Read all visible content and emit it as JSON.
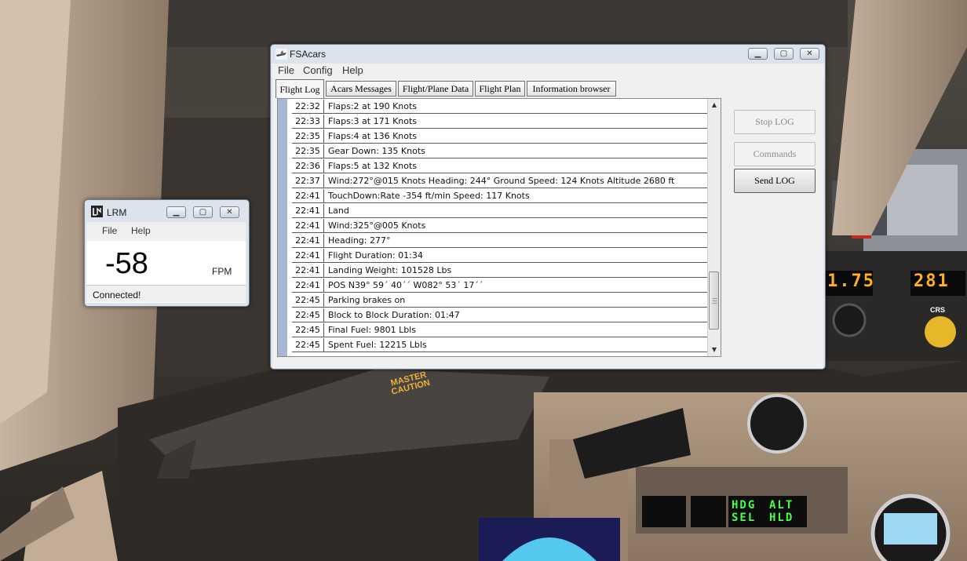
{
  "scene": {
    "caution_line1": "MASTER",
    "caution_line2": "CAUTION",
    "led_course_left": "1.75",
    "led_course_right": "281",
    "crs_label": "CRS",
    "fma_left": "HDG SEL",
    "fma_right": "ALT HLD"
  },
  "fsacars": {
    "title": "FSAcars",
    "menu": [
      "File",
      "Config",
      "Help"
    ],
    "tabs": [
      "Flight Log",
      "Acars Messages",
      "Flight/Plane Data",
      "Flight Plan",
      "Information browser"
    ],
    "active_tab": "Flight Log",
    "log": [
      {
        "time": "22:32",
        "text": "Flaps:2 at 190 Knots"
      },
      {
        "time": "22:33",
        "text": "Flaps:3 at 171 Knots"
      },
      {
        "time": "22:35",
        "text": "Flaps:4 at 136 Knots"
      },
      {
        "time": "22:35",
        "text": "Gear Down: 135 Knots"
      },
      {
        "time": "22:36",
        "text": "Flaps:5 at 132 Knots"
      },
      {
        "time": "22:37",
        "text": "Wind:272°@015 Knots Heading: 244° Ground Speed: 124 Knots Altitude 2680 ft"
      },
      {
        "time": "22:41",
        "text": "TouchDown:Rate -354 ft/min Speed: 117 Knots"
      },
      {
        "time": "22:41",
        "text": "Land"
      },
      {
        "time": "22:41",
        "text": "Wind:325°@005 Knots"
      },
      {
        "time": "22:41",
        "text": "Heading: 277°"
      },
      {
        "time": "22:41",
        "text": "Flight Duration: 01:34"
      },
      {
        "time": "22:41",
        "text": "Landing Weight: 101528 Lbs"
      },
      {
        "time": "22:41",
        "text": "POS N39° 59´ 40´´ W082° 53´ 17´´"
      },
      {
        "time": "22:45",
        "text": "Parking brakes on"
      },
      {
        "time": "22:45",
        "text": "Block to Block Duration: 01:47"
      },
      {
        "time": "22:45",
        "text": "Final Fuel: 9801 Lbls"
      },
      {
        "time": "22:45",
        "text": "Spent Fuel: 12215 Lbls"
      }
    ],
    "buttons": {
      "stop_log": "Stop LOG",
      "commands": "Commands",
      "send_log": "Send LOG"
    }
  },
  "lrm": {
    "title": "LRM",
    "menu": [
      "File",
      "Help"
    ],
    "value": "-58",
    "unit": "FPM",
    "status": "Connected!"
  },
  "colors": {
    "title_bar": "#dce3ec",
    "log_strip": "#a8b8d4",
    "led_amber": "#ffb020",
    "led_green": "#46ff4a"
  }
}
